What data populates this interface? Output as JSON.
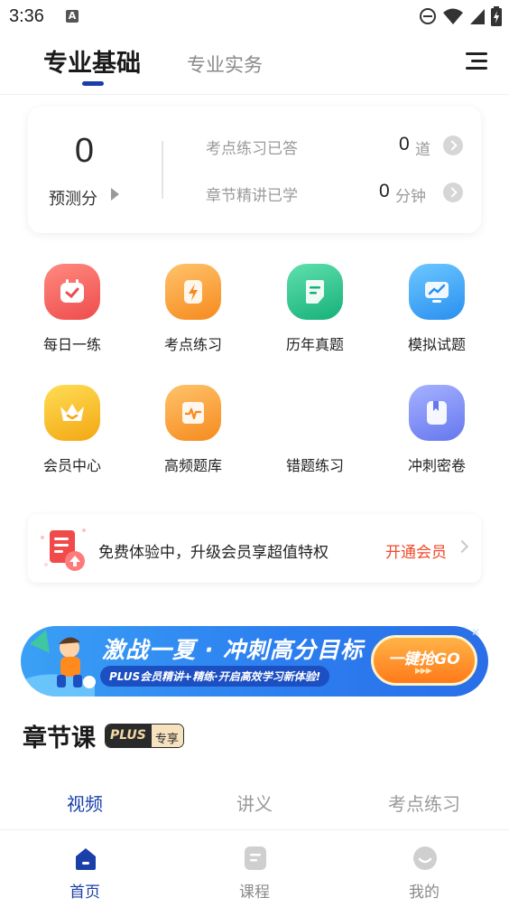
{
  "status_bar": {
    "time": "3:36",
    "notification_letter": "A"
  },
  "header": {
    "tab_active": "专业基础",
    "tab_inactive": "专业实务"
  },
  "stats": {
    "score_value": "0",
    "score_label": "预测分",
    "rows": [
      {
        "label": "考点练习已答",
        "value": "0",
        "unit": "道"
      },
      {
        "label": "章节精讲已学",
        "value": "0",
        "unit": "分钟"
      }
    ]
  },
  "grid": [
    {
      "label": "每日一练",
      "icon": "calendar-check-icon",
      "color": "#f15b5b"
    },
    {
      "label": "考点练习",
      "icon": "lightning-doc-icon",
      "color": "#f79a2a"
    },
    {
      "label": "历年真题",
      "icon": "document-icon",
      "color": "#24c28a"
    },
    {
      "label": "模拟试题",
      "icon": "monitor-chart-icon",
      "color": "#2e9bf0"
    },
    {
      "label": "会员中心",
      "icon": "crown-icon",
      "color": "#f7b41f"
    },
    {
      "label": "高频题库",
      "icon": "heartbeat-doc-icon",
      "color": "#f79a2a"
    },
    {
      "label": "错题练习",
      "icon": "none",
      "color": "#ffffff"
    },
    {
      "label": "冲刺密卷",
      "icon": "book-bookmark-icon",
      "color": "#6a7cf0"
    }
  ],
  "member": {
    "text": "免费体验中，升级会员享超值特权",
    "cta": "开通会员"
  },
  "promo": {
    "title": "激战一夏 · 冲刺高分目标",
    "subtitle": "PLUS会员精讲+精练·开启高效学习新体验!",
    "button": "一键抢GO",
    "arrows": "▶▶▶",
    "close": "✕"
  },
  "chapter": {
    "title": "章节课",
    "badge_left": "PLUS",
    "badge_right": "专享"
  },
  "sub_tabs": [
    "视频",
    "讲义",
    "考点练习"
  ],
  "bottom_nav": [
    {
      "label": "首页",
      "icon": "home-icon"
    },
    {
      "label": "课程",
      "icon": "course-icon"
    },
    {
      "label": "我的",
      "icon": "profile-icon"
    }
  ],
  "colors": {
    "accent": "#1a3fa8",
    "cta": "#f04a2a"
  }
}
